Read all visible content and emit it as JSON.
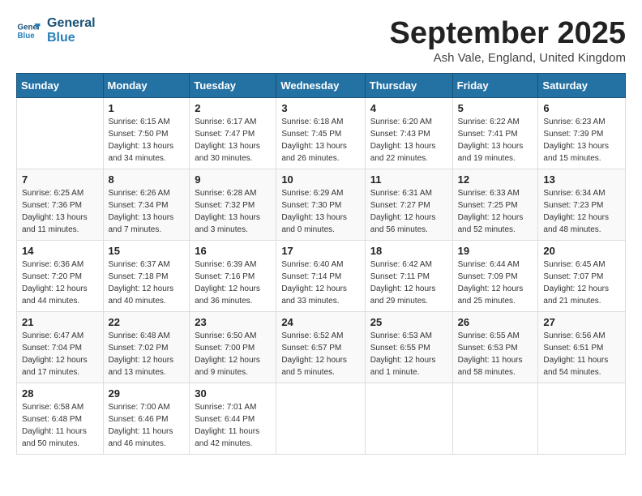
{
  "logo": {
    "line1": "General",
    "line2": "Blue"
  },
  "title": "September 2025",
  "location": "Ash Vale, England, United Kingdom",
  "headers": [
    "Sunday",
    "Monday",
    "Tuesday",
    "Wednesday",
    "Thursday",
    "Friday",
    "Saturday"
  ],
  "weeks": [
    [
      {
        "day": "",
        "sunrise": "",
        "sunset": "",
        "daylight": ""
      },
      {
        "day": "1",
        "sunrise": "Sunrise: 6:15 AM",
        "sunset": "Sunset: 7:50 PM",
        "daylight": "Daylight: 13 hours and 34 minutes."
      },
      {
        "day": "2",
        "sunrise": "Sunrise: 6:17 AM",
        "sunset": "Sunset: 7:47 PM",
        "daylight": "Daylight: 13 hours and 30 minutes."
      },
      {
        "day": "3",
        "sunrise": "Sunrise: 6:18 AM",
        "sunset": "Sunset: 7:45 PM",
        "daylight": "Daylight: 13 hours and 26 minutes."
      },
      {
        "day": "4",
        "sunrise": "Sunrise: 6:20 AM",
        "sunset": "Sunset: 7:43 PM",
        "daylight": "Daylight: 13 hours and 22 minutes."
      },
      {
        "day": "5",
        "sunrise": "Sunrise: 6:22 AM",
        "sunset": "Sunset: 7:41 PM",
        "daylight": "Daylight: 13 hours and 19 minutes."
      },
      {
        "day": "6",
        "sunrise": "Sunrise: 6:23 AM",
        "sunset": "Sunset: 7:39 PM",
        "daylight": "Daylight: 13 hours and 15 minutes."
      }
    ],
    [
      {
        "day": "7",
        "sunrise": "Sunrise: 6:25 AM",
        "sunset": "Sunset: 7:36 PM",
        "daylight": "Daylight: 13 hours and 11 minutes."
      },
      {
        "day": "8",
        "sunrise": "Sunrise: 6:26 AM",
        "sunset": "Sunset: 7:34 PM",
        "daylight": "Daylight: 13 hours and 7 minutes."
      },
      {
        "day": "9",
        "sunrise": "Sunrise: 6:28 AM",
        "sunset": "Sunset: 7:32 PM",
        "daylight": "Daylight: 13 hours and 3 minutes."
      },
      {
        "day": "10",
        "sunrise": "Sunrise: 6:29 AM",
        "sunset": "Sunset: 7:30 PM",
        "daylight": "Daylight: 13 hours and 0 minutes."
      },
      {
        "day": "11",
        "sunrise": "Sunrise: 6:31 AM",
        "sunset": "Sunset: 7:27 PM",
        "daylight": "Daylight: 12 hours and 56 minutes."
      },
      {
        "day": "12",
        "sunrise": "Sunrise: 6:33 AM",
        "sunset": "Sunset: 7:25 PM",
        "daylight": "Daylight: 12 hours and 52 minutes."
      },
      {
        "day": "13",
        "sunrise": "Sunrise: 6:34 AM",
        "sunset": "Sunset: 7:23 PM",
        "daylight": "Daylight: 12 hours and 48 minutes."
      }
    ],
    [
      {
        "day": "14",
        "sunrise": "Sunrise: 6:36 AM",
        "sunset": "Sunset: 7:20 PM",
        "daylight": "Daylight: 12 hours and 44 minutes."
      },
      {
        "day": "15",
        "sunrise": "Sunrise: 6:37 AM",
        "sunset": "Sunset: 7:18 PM",
        "daylight": "Daylight: 12 hours and 40 minutes."
      },
      {
        "day": "16",
        "sunrise": "Sunrise: 6:39 AM",
        "sunset": "Sunset: 7:16 PM",
        "daylight": "Daylight: 12 hours and 36 minutes."
      },
      {
        "day": "17",
        "sunrise": "Sunrise: 6:40 AM",
        "sunset": "Sunset: 7:14 PM",
        "daylight": "Daylight: 12 hours and 33 minutes."
      },
      {
        "day": "18",
        "sunrise": "Sunrise: 6:42 AM",
        "sunset": "Sunset: 7:11 PM",
        "daylight": "Daylight: 12 hours and 29 minutes."
      },
      {
        "day": "19",
        "sunrise": "Sunrise: 6:44 AM",
        "sunset": "Sunset: 7:09 PM",
        "daylight": "Daylight: 12 hours and 25 minutes."
      },
      {
        "day": "20",
        "sunrise": "Sunrise: 6:45 AM",
        "sunset": "Sunset: 7:07 PM",
        "daylight": "Daylight: 12 hours and 21 minutes."
      }
    ],
    [
      {
        "day": "21",
        "sunrise": "Sunrise: 6:47 AM",
        "sunset": "Sunset: 7:04 PM",
        "daylight": "Daylight: 12 hours and 17 minutes."
      },
      {
        "day": "22",
        "sunrise": "Sunrise: 6:48 AM",
        "sunset": "Sunset: 7:02 PM",
        "daylight": "Daylight: 12 hours and 13 minutes."
      },
      {
        "day": "23",
        "sunrise": "Sunrise: 6:50 AM",
        "sunset": "Sunset: 7:00 PM",
        "daylight": "Daylight: 12 hours and 9 minutes."
      },
      {
        "day": "24",
        "sunrise": "Sunrise: 6:52 AM",
        "sunset": "Sunset: 6:57 PM",
        "daylight": "Daylight: 12 hours and 5 minutes."
      },
      {
        "day": "25",
        "sunrise": "Sunrise: 6:53 AM",
        "sunset": "Sunset: 6:55 PM",
        "daylight": "Daylight: 12 hours and 1 minute."
      },
      {
        "day": "26",
        "sunrise": "Sunrise: 6:55 AM",
        "sunset": "Sunset: 6:53 PM",
        "daylight": "Daylight: 11 hours and 58 minutes."
      },
      {
        "day": "27",
        "sunrise": "Sunrise: 6:56 AM",
        "sunset": "Sunset: 6:51 PM",
        "daylight": "Daylight: 11 hours and 54 minutes."
      }
    ],
    [
      {
        "day": "28",
        "sunrise": "Sunrise: 6:58 AM",
        "sunset": "Sunset: 6:48 PM",
        "daylight": "Daylight: 11 hours and 50 minutes."
      },
      {
        "day": "29",
        "sunrise": "Sunrise: 7:00 AM",
        "sunset": "Sunset: 6:46 PM",
        "daylight": "Daylight: 11 hours and 46 minutes."
      },
      {
        "day": "30",
        "sunrise": "Sunrise: 7:01 AM",
        "sunset": "Sunset: 6:44 PM",
        "daylight": "Daylight: 11 hours and 42 minutes."
      },
      {
        "day": "",
        "sunrise": "",
        "sunset": "",
        "daylight": ""
      },
      {
        "day": "",
        "sunrise": "",
        "sunset": "",
        "daylight": ""
      },
      {
        "day": "",
        "sunrise": "",
        "sunset": "",
        "daylight": ""
      },
      {
        "day": "",
        "sunrise": "",
        "sunset": "",
        "daylight": ""
      }
    ]
  ]
}
